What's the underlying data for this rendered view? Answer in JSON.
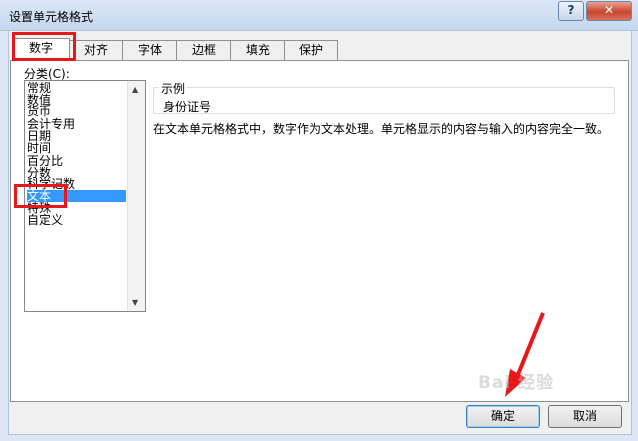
{
  "window": {
    "title": "设置单元格格式",
    "help_label": "?",
    "close_label": "✕"
  },
  "tabs": [
    {
      "label": "数字",
      "active": true
    },
    {
      "label": "对齐",
      "active": false
    },
    {
      "label": "字体",
      "active": false
    },
    {
      "label": "边框",
      "active": false
    },
    {
      "label": "填充",
      "active": false
    },
    {
      "label": "保护",
      "active": false
    }
  ],
  "category": {
    "label": "分类(C):",
    "items": [
      "常规",
      "数值",
      "货币",
      "会计专用",
      "日期",
      "时间",
      "百分比",
      "分数",
      "科学记数",
      "文本",
      "特殊",
      "自定义"
    ],
    "selected": "文本"
  },
  "sample": {
    "legend": "示例",
    "value": "身份证号"
  },
  "description": "在文本单元格格式中，数字作为文本处理。单元格显示的内容与输入的内容完全一致。",
  "buttons": {
    "ok": "确定",
    "cancel": "取消"
  },
  "watermark": "Bai 经验",
  "annotations": {
    "highlight_color": "#e8171b",
    "arrow_color": "#e8171b"
  }
}
